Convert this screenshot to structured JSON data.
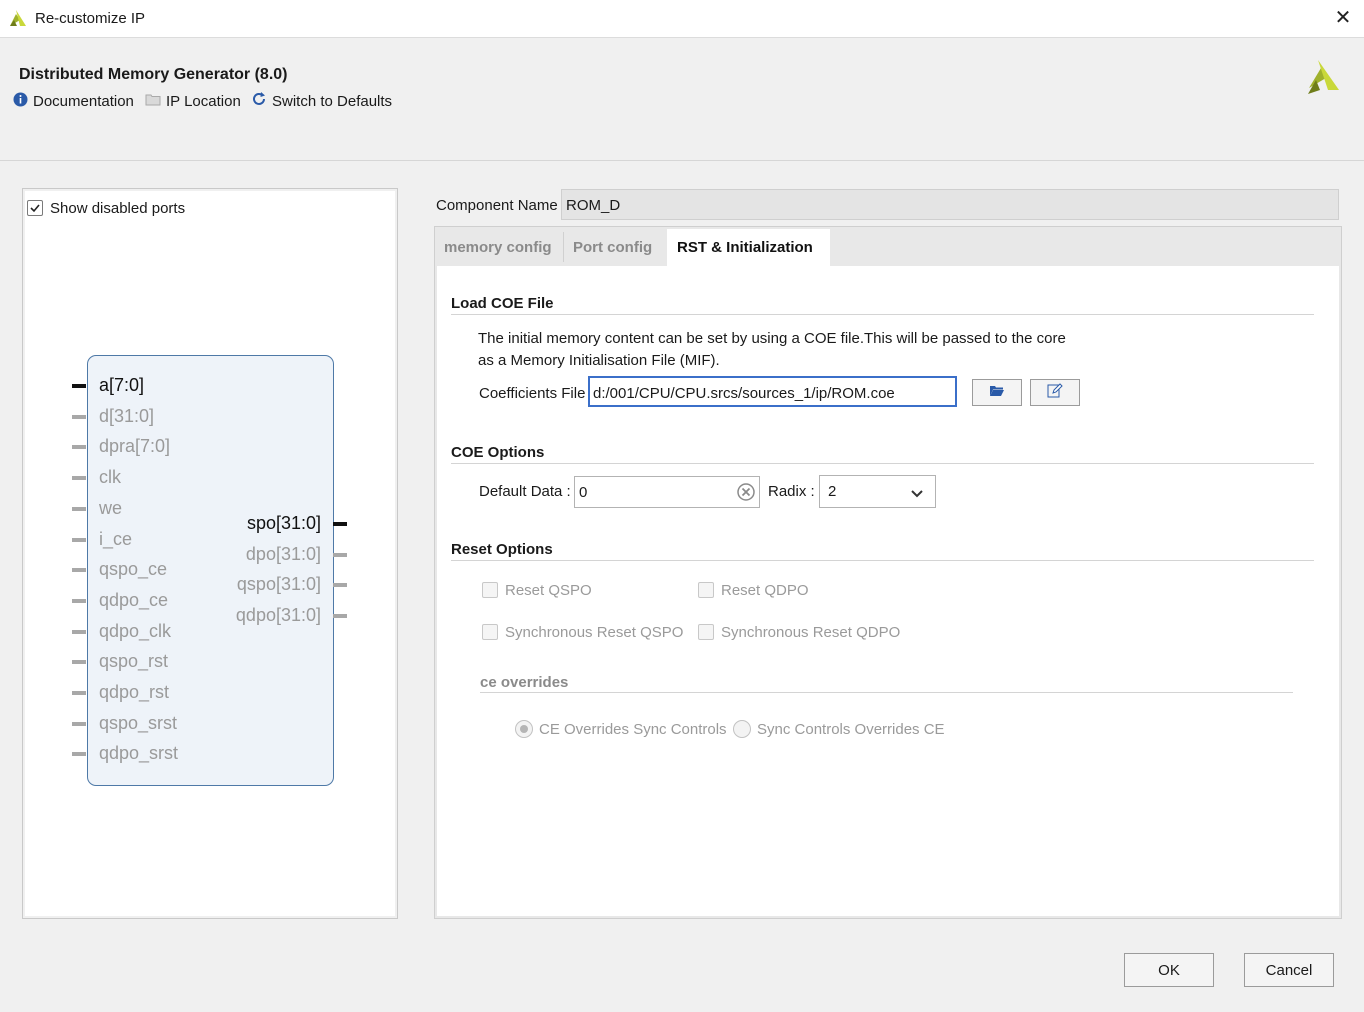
{
  "window": {
    "title": "Re-customize IP"
  },
  "header": {
    "title": "Distributed Memory Generator (8.0)",
    "toolbar": [
      {
        "icon": "info-icon",
        "label": "Documentation"
      },
      {
        "icon": "folder-icon",
        "label": "IP Location"
      },
      {
        "icon": "refresh-icon",
        "label": "Switch to Defaults"
      }
    ]
  },
  "left_panel": {
    "show_disabled_ports_label": "Show disabled ports",
    "show_disabled_ports_checked": true,
    "inputs": [
      {
        "name": "a[7:0]",
        "active": true
      },
      {
        "name": "d[31:0]",
        "active": false
      },
      {
        "name": "dpra[7:0]",
        "active": false
      },
      {
        "name": "clk",
        "active": false
      },
      {
        "name": "we",
        "active": false
      },
      {
        "name": "i_ce",
        "active": false
      },
      {
        "name": "qspo_ce",
        "active": false
      },
      {
        "name": "qdpo_ce",
        "active": false
      },
      {
        "name": "qdpo_clk",
        "active": false
      },
      {
        "name": "qspo_rst",
        "active": false
      },
      {
        "name": "qdpo_rst",
        "active": false
      },
      {
        "name": "qspo_srst",
        "active": false
      },
      {
        "name": "qdpo_srst",
        "active": false
      }
    ],
    "outputs": [
      {
        "name": "spo[31:0]",
        "active": true
      },
      {
        "name": "dpo[31:0]",
        "active": false
      },
      {
        "name": "qspo[31:0]",
        "active": false
      },
      {
        "name": "qdpo[31:0]",
        "active": false
      }
    ]
  },
  "component": {
    "label": "Component Name",
    "value": "ROM_D"
  },
  "tabs": [
    {
      "label": "memory config",
      "active": false
    },
    {
      "label": "Port config",
      "active": false
    },
    {
      "label": "RST & Initialization",
      "active": true
    }
  ],
  "load_coe": {
    "section_title": "Load COE File",
    "description_line1": "The initial memory content can be set by using a COE file.This will be passed to the core",
    "description_line2": "as a Memory Initialisation File (MIF).",
    "coef_label": "Coefficients File",
    "coef_value": "d:/001/CPU/CPU.srcs/sources_1/ip/ROM.coe"
  },
  "coe_options": {
    "section_title": "COE Options",
    "default_data_label": "Default Data :",
    "default_data_value": "0",
    "radix_label": "Radix :",
    "radix_value": "2"
  },
  "reset_options": {
    "section_title": "Reset Options",
    "reset_qspo": "Reset QSPO",
    "reset_qdpo": "Reset QDPO",
    "sync_reset_qspo": "Synchronous Reset QSPO",
    "sync_reset_qdpo": "Synchronous Reset QDPO",
    "ce_title": "ce overrides",
    "ce_overrides_sync": "CE Overrides Sync Controls",
    "sync_overrides_ce": "Sync Controls Overrides CE",
    "selected": "CE Overrides Sync Controls"
  },
  "footer": {
    "ok_label": "OK",
    "cancel_label": "Cancel"
  },
  "colors": {
    "accent": "#3b6fc9",
    "brand": "#b5c428",
    "symbol_border": "#4e79a7"
  }
}
